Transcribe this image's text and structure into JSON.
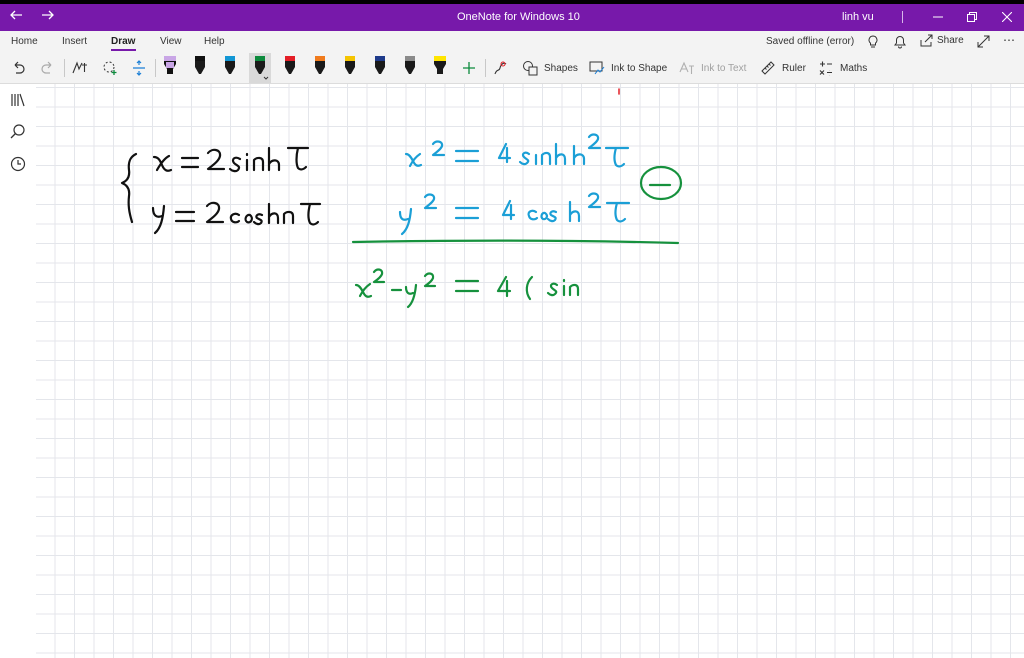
{
  "titlebar": {
    "back_icon": "arrow-left-icon",
    "forward_icon": "arrow-right-icon",
    "app_title": "OneNote for Windows 10",
    "user_name": "linh vu",
    "minimize_icon": "minimize-icon",
    "restore_icon": "restore-icon",
    "close_icon": "close-icon"
  },
  "menubar": {
    "tabs": [
      {
        "label": "Home"
      },
      {
        "label": "Insert"
      },
      {
        "label": "Draw"
      },
      {
        "label": "View"
      },
      {
        "label": "Help"
      }
    ],
    "status": "Saved offline (error)",
    "share_label": "Share"
  },
  "toolbar": {
    "shapes_label": "Shapes",
    "ink_to_shape_label": "Ink to Shape",
    "ink_to_text_label": "Ink to Text",
    "ruler_label": "Ruler",
    "maths_label": "Maths",
    "pens": [
      {
        "color": "#c9a6e6",
        "name": "highlighter-pen"
      },
      {
        "color": "#111111",
        "name": "black-pen"
      },
      {
        "color": "#1296d4",
        "name": "blue-pen"
      },
      {
        "color": "#0c8a3c",
        "name": "green-pen"
      },
      {
        "color": "#e41e26",
        "name": "red-pen"
      },
      {
        "color": "#f07b1d",
        "name": "orange-pen"
      },
      {
        "color": "#f5c400",
        "name": "yellow-pen"
      },
      {
        "color": "#1e3a8a",
        "name": "navy-pen"
      },
      {
        "color": "#8a8a8a",
        "name": "gray-pen"
      },
      {
        "color": "#ffe500",
        "name": "yellow-highlighter"
      }
    ]
  },
  "colors": {
    "accent": "#7719aa",
    "ink_black": "#111111",
    "ink_blue": "#1b9fd6",
    "ink_green": "#16913d"
  }
}
